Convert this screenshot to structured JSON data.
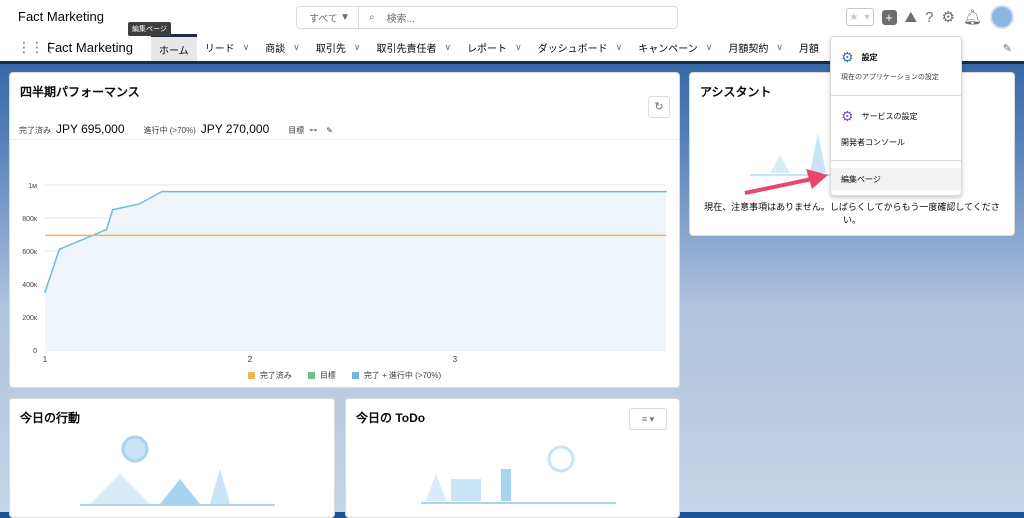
{
  "header": {
    "app_name": "Fact Marketing",
    "search_scope": "すべて",
    "search_placeholder": "検索...",
    "tooltip": "編集ページ"
  },
  "nav": {
    "title": "Fact Marketing",
    "tabs": [
      {
        "label": "ホーム"
      },
      {
        "label": "リード"
      },
      {
        "label": "商談"
      },
      {
        "label": "取引先"
      },
      {
        "label": "取引先責任者"
      },
      {
        "label": "レポート"
      },
      {
        "label": "ダッシュボード"
      },
      {
        "label": "キャンペーン"
      },
      {
        "label": "月額契約"
      },
      {
        "label": "月額"
      }
    ]
  },
  "performance": {
    "title": "四半期パフォーマンス",
    "closed_label": "完了済み",
    "closed_value": "JPY 695,000",
    "open_label": "進行中 (>70%)",
    "open_value": "JPY 270,000",
    "goal_label": "目標",
    "goal_value": "--"
  },
  "chart_data": {
    "type": "line",
    "xlim": [
      1,
      4.03
    ],
    "ylim": [
      0,
      1000000
    ],
    "yticks": [
      "0",
      "200к",
      "400к",
      "600к",
      "800к",
      "1м"
    ],
    "yvals": [
      0,
      200000,
      400000,
      600000,
      800000,
      1000000
    ],
    "xticks": [
      "1",
      "2",
      "3"
    ],
    "xtick_vals": [
      1,
      2,
      3
    ],
    "series": [
      {
        "name": "完了済み",
        "color": "#f4b25d",
        "x": [
          1,
          4.03
        ],
        "y": [
          695000,
          695000
        ]
      },
      {
        "name": "目標",
        "color": "#6fc18b",
        "x": [],
        "y": []
      },
      {
        "name": "完了 + 進行中 (>70%)",
        "color": "#70b8dc",
        "x": [
          1,
          1.07,
          1.3,
          1.33,
          1.46,
          1.57,
          4.03
        ],
        "y": [
          350000,
          610000,
          730000,
          850000,
          885000,
          960000,
          960000
        ]
      }
    ]
  },
  "assistant": {
    "title": "アシスタント",
    "message": "現在、注意事項はありません。しばらくしてからもう一度確認してください。"
  },
  "events": {
    "title": "今日の行動"
  },
  "todo": {
    "title": "今日の ToDo"
  },
  "menu": {
    "setup": "設定",
    "setup_sub": "現在のアプリケーションの設定",
    "service_setup": "サービスの設定",
    "dev_console": "開発者コンソール",
    "edit_page": "編集ページ"
  }
}
